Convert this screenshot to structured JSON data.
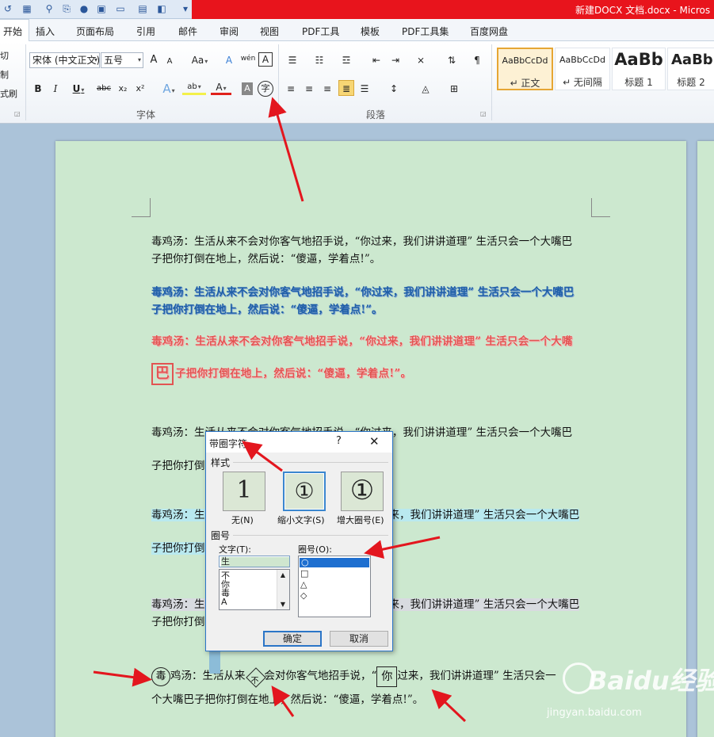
{
  "window": {
    "title": "新建DOCX 文档.docx - Micros"
  },
  "tabs": [
    "开始",
    "插入",
    "页面布局",
    "引用",
    "邮件",
    "审阅",
    "视图",
    "PDF工具",
    "模板",
    "PDF工具集",
    "百度网盘"
  ],
  "clipboard": {
    "cut": "切",
    "copy": "制",
    "format_painter": "式刷"
  },
  "font": {
    "name": "宋体 (中文正文)",
    "size": "五号",
    "group_label": "字体",
    "grow": "A",
    "shrink": "A",
    "change_case": "Aa",
    "clear_format": "A",
    "phonetic": "wén",
    "char_border": "A",
    "bold": "B",
    "italic": "I",
    "underline": "U",
    "strike": "abc",
    "subscript": "x₂",
    "superscript": "x²",
    "text_effect": "A",
    "highlight": "ab",
    "font_color": "A",
    "char_shading": "A",
    "enclose_char": "字"
  },
  "paragraph": {
    "group_label": "段落"
  },
  "styles": [
    {
      "sample": "AaBbCcDd",
      "name": "↵ 正文"
    },
    {
      "sample": "AaBbCcDd",
      "name": "↵ 无间隔"
    },
    {
      "sample": "AaBb",
      "name": "标题 1"
    },
    {
      "sample": "AaBb",
      "name": "标题 2"
    }
  ],
  "document": {
    "p1_line1": "毒鸡汤：生活从来不会对你客气地招手说，“你过来，我们讲讲道理” 生活只会一个大嘴巴",
    "p1_line2": "子把你打倒在地上，然后说：“傻逼，学着点!”。",
    "p2_line1": "毒鸡汤：生活从来不会对你客气地招手说，“你过来，我们讲讲道理” 生活只会一个大嘴巴",
    "p2_line2": "子把你打倒在地上，然后说：“傻逼，学着点!”。",
    "p3_line1": "毒鸡汤：生活从来不会对你客气地招手说，“你过来，我们讲讲道理” 生活只会一个大嘴",
    "p3_big_char": "巴",
    "p3_line2": "子把你打倒在地上，然后说：“傻逼，学着点!”。",
    "p4_line1_a": "毒鸡汤：生活从来不会对你客气地招手说，“你过来，我们讲讲道理” 生活只会一个大嘴巴",
    "p4_line2_a": "子把你打倒",
    "p5_line1_a": "毒鸡汤：生",
    "p5_line1_b": "来，我们讲讲道理” 生活只会一个大嘴巴",
    "p5_line2_a": "子把你打倒",
    "p6_line1_a": "毒鸡汤：生",
    "p6_line1_b": "来，我们讲讲道理” 生活只会一个大嘴巴",
    "p6_line2_a": "子把你打倒",
    "p7_enc1": "毒",
    "p7_text1": "鸡汤：生活从来",
    "p7_enc2": "不",
    "p7_text2": "会对你客气地招手说，“",
    "p7_enc3": "你",
    "p7_text3": "过来，我们讲讲道理” 生活只会一",
    "p7_line2": "个大嘴巴子把你打倒在地上，然后说：“傻逼，学着点!”。"
  },
  "dialog": {
    "title": "带圈字符",
    "help": "?",
    "close": "✕",
    "style_label": "样式",
    "options": [
      {
        "glyph": "1",
        "label": "无(N)"
      },
      {
        "glyph": "①",
        "label": "缩小文字(S)"
      },
      {
        "glyph": "①",
        "label": "增大圈号(E)"
      }
    ],
    "enclosure_label": "圈号",
    "text_label": "文字(T):",
    "text_value": "生",
    "text_items": [
      "不",
      "你",
      "毒",
      "A"
    ],
    "shape_label": "圈号(O):",
    "shape_items": [
      "○",
      "□",
      "△",
      "◇"
    ],
    "ok": "确定",
    "cancel": "取消"
  },
  "watermark": {
    "main": "Baidu经验",
    "sub": "jingyan.baidu.com"
  }
}
